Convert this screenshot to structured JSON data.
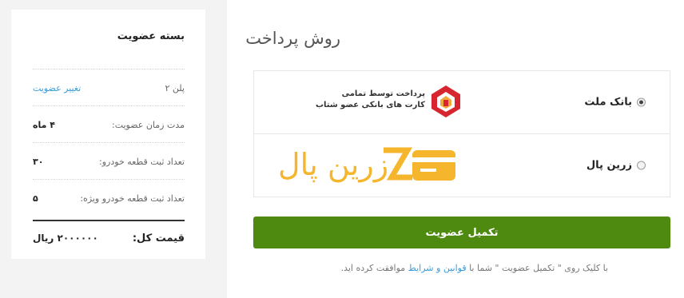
{
  "payment": {
    "title": "روش پرداخت",
    "methods": [
      {
        "label": "بانک ملت",
        "selected": true,
        "logo_line1": "پرداخت توسط تمامی",
        "logo_line2": "کارت های بانکی عضو شتاب"
      },
      {
        "label": "زرین پال",
        "selected": false,
        "logo_text": "زرین پال"
      }
    ],
    "submit_label": "تکمیل عضویت",
    "terms_prefix": "با کلیک روی \" تکمیل عضویت \" شما با",
    "terms_link": "قوانین و شرایط",
    "terms_suffix": "موافقت کرده اید."
  },
  "membership": {
    "title": "بسته عضویت",
    "plan_label": "پلن ۲",
    "change_link": "تغییر عضویت",
    "rows": [
      {
        "label": "مدت زمان عضویت:",
        "value": "۴ ماه"
      },
      {
        "label": "تعداد ثبت قطعه خودرو:",
        "value": "۳۰"
      },
      {
        "label": "تعداد ثبت قطعه خودرو ویژه:",
        "value": "۵"
      }
    ],
    "total_label": "قیمت کل:",
    "total_value": "۲۰۰۰۰۰۰ ریال"
  },
  "colors": {
    "accent_green": "#4f8a10",
    "link_blue": "#3a9bd9",
    "zarinpal_yellow": "#f5b62d",
    "mellat_red": "#d7262f"
  }
}
